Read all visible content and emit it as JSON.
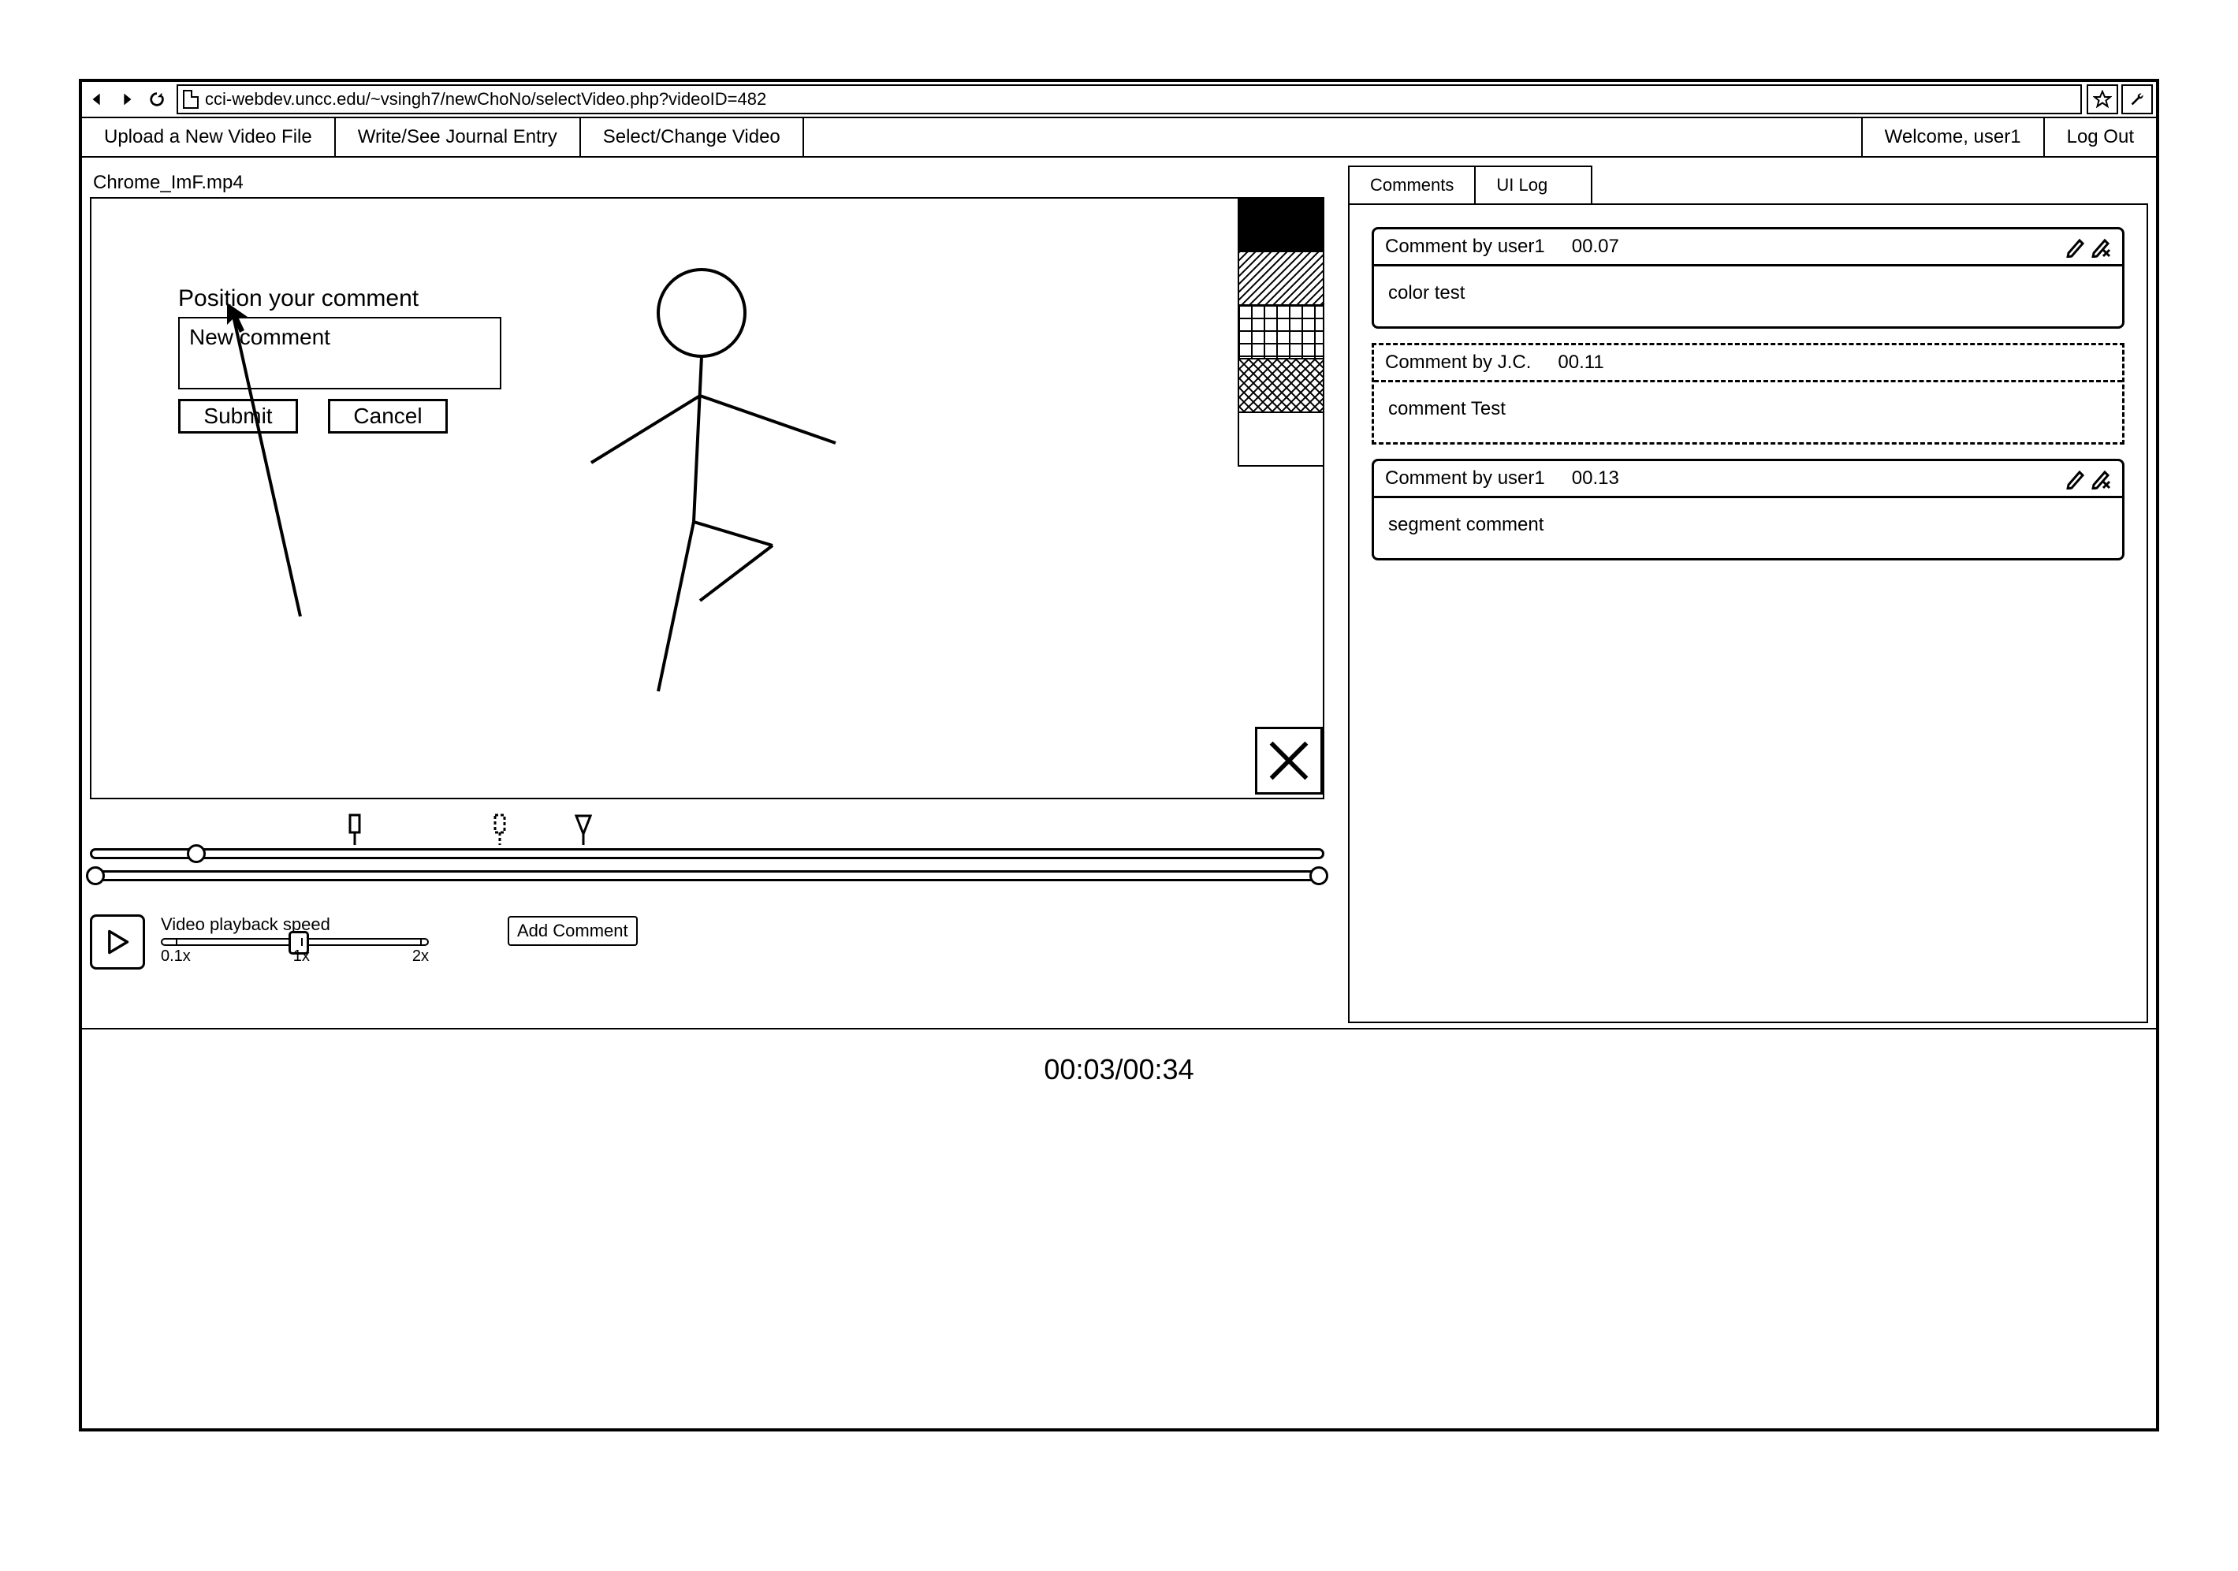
{
  "browser": {
    "url": "cci-webdev.uncc.edu/~vsingh7/newChoNo/selectVideo.php?videoID=482"
  },
  "menu": {
    "upload": "Upload a New Video File",
    "journal": "Write/See Journal Entry",
    "select": "Select/Change Video",
    "welcome": "Welcome, user1",
    "logout": "Log Out"
  },
  "video": {
    "filename": "Chrome_ImF.mp4",
    "time_display": "00:03/00:34"
  },
  "popup": {
    "title": "Position your comment",
    "value": "New comment",
    "submit": "Submit",
    "cancel": "Cancel"
  },
  "controls": {
    "speed_label": "Video playback speed",
    "speed_ticks": {
      "min": "0.1x",
      "mid": "1x",
      "max": "2x"
    },
    "add_comment": "Add Comment"
  },
  "tabs": {
    "comments": "Comments",
    "uilog": "UI Log"
  },
  "comments": [
    {
      "author": "Comment by user1",
      "time": "00.07",
      "body": "color test",
      "editable": true,
      "style": "solid"
    },
    {
      "author": "Comment by J.C.",
      "time": "00.11",
      "body": "comment Test",
      "editable": false,
      "style": "dashed"
    },
    {
      "author": "Comment by user1",
      "time": "00.13",
      "body": "segment comment",
      "editable": true,
      "style": "solid"
    }
  ]
}
